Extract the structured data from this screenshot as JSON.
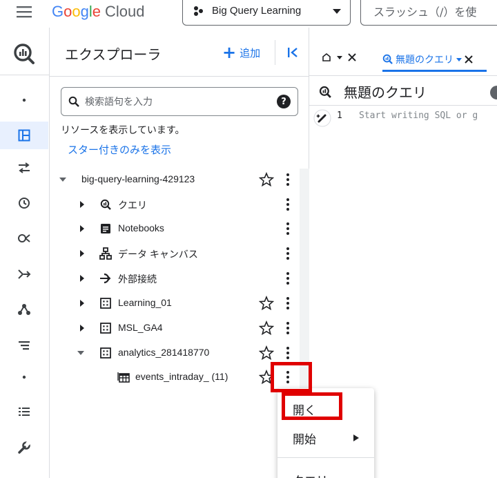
{
  "topbar": {
    "logo_parts": [
      "G",
      "o",
      "o",
      "g",
      "l",
      "e"
    ],
    "logo_cloud": "Cloud",
    "project_name": "Big Query Learning",
    "search_placeholder": "スラッシュ（/）を使"
  },
  "explorer": {
    "title": "エクスプローラ",
    "add_label": "追加",
    "search_placeholder": "検索語句を入力",
    "help_label": "?",
    "resource_message": "リソースを表示しています。",
    "starred_link": "スター付きのみを表示",
    "tree": [
      {
        "label": "big-query-learning-429123",
        "icon": "none",
        "expanded": true,
        "starred_available": true
      },
      {
        "label": "クエリ",
        "icon": "bigquery-query-icon"
      },
      {
        "label": "Notebooks",
        "icon": "notebook-icon"
      },
      {
        "label": "データ キャンバス",
        "icon": "data-canvas-icon"
      },
      {
        "label": "外部接続",
        "icon": "external-connection-icon"
      },
      {
        "label": "Learning_01",
        "icon": "dataset-icon"
      },
      {
        "label": "MSL_GA4",
        "icon": "dataset-icon"
      },
      {
        "label": "analytics_281418770",
        "icon": "dataset-icon",
        "expanded": true
      },
      {
        "label": "events_intraday_ (11)",
        "icon": "sharded-table-icon"
      }
    ]
  },
  "editor": {
    "tab_label": "無題のクエリ",
    "query_title": "無題のクエリ",
    "line_number": "1",
    "code_hint": "Start writing SQL or g"
  },
  "context_menu": {
    "items": [
      "開く",
      "開始",
      "クエリ"
    ]
  },
  "colors": {
    "accent": "#1a73e8",
    "highlight": "#e00000",
    "rail_active": "#e8f0fe"
  }
}
